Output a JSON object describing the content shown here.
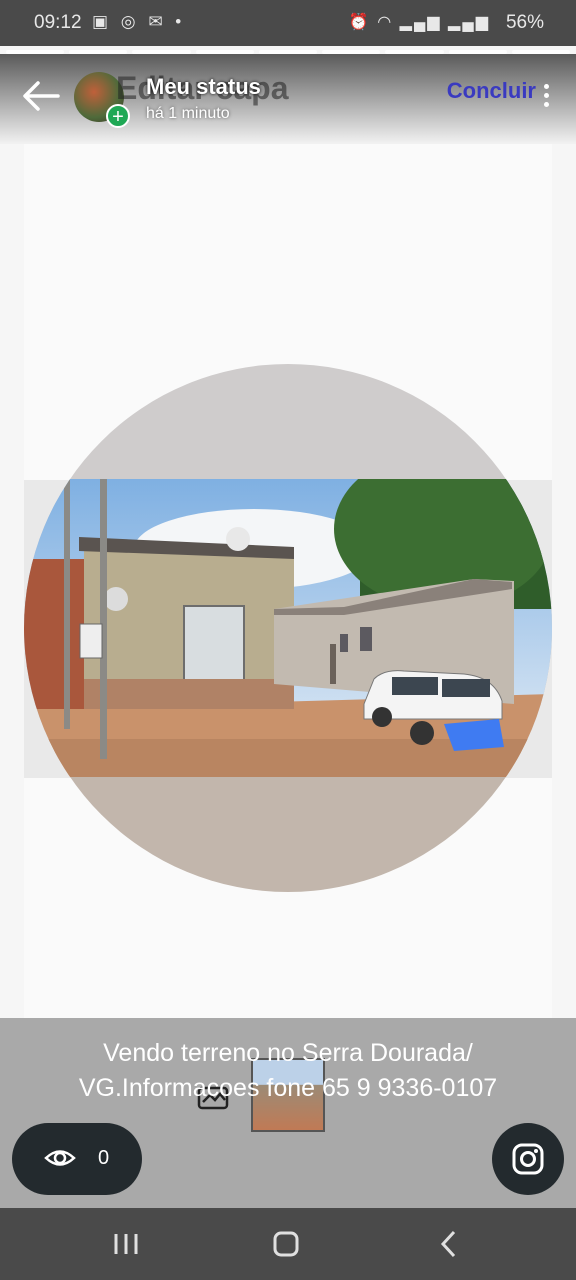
{
  "status_bar": {
    "time": "09:12",
    "battery": "56%"
  },
  "header": {
    "ghost_text": "Editar capa",
    "title": "Meu status",
    "subtitle": "há 1 minuto",
    "done_label": "Concluir"
  },
  "caption": {
    "line1": "Vendo terreno no Serra Dourada/",
    "line2": "VG.Informacoes fone 65 9 9336-0107"
  },
  "views": {
    "count": "0"
  },
  "icons": {
    "back": "back-arrow-icon",
    "menu": "more-vert-icon",
    "views": "eye-icon",
    "share": "instagram-icon",
    "crop": "crop-icon"
  },
  "colors": {
    "accent": "#3a3ac0",
    "add_badge": "#1fa855",
    "pill": "#232a2e"
  }
}
